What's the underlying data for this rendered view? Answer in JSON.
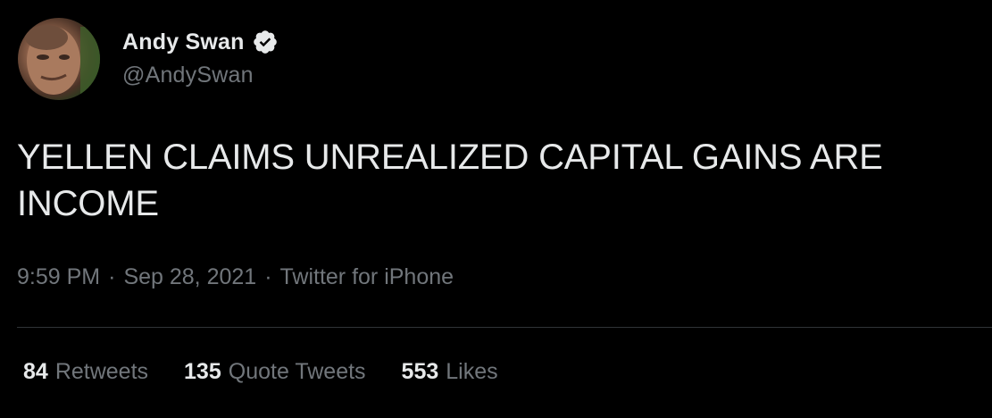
{
  "author": {
    "display_name": "Andy Swan",
    "handle": "@AndySwan",
    "verified": true,
    "avatar_icon": "profile-photo"
  },
  "tweet": {
    "text": "YELLEN CLAIMS UNREALIZED CAPITAL GAINS ARE INCOME"
  },
  "meta": {
    "time": "9:59 PM",
    "separator": "·",
    "date": "Sep 28, 2021",
    "source": "Twitter for iPhone"
  },
  "stats": {
    "retweets": {
      "count": "84",
      "label": "Retweets"
    },
    "quote_tweets": {
      "count": "135",
      "label": "Quote Tweets"
    },
    "likes": {
      "count": "553",
      "label": "Likes"
    }
  },
  "colors": {
    "background": "#000000",
    "primary_text": "#e7e9ea",
    "secondary_text": "#71767b",
    "divider": "#2f3336"
  }
}
